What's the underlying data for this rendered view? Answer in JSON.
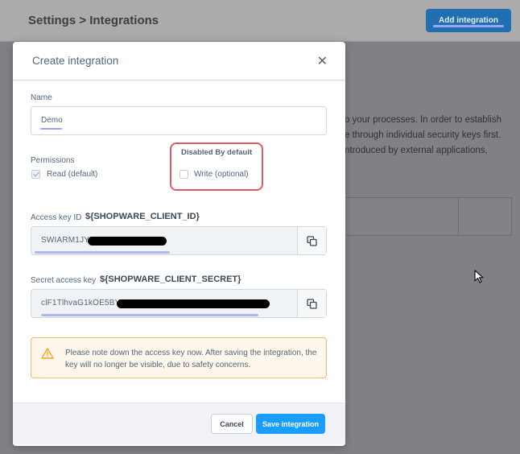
{
  "background": {
    "breadcrumb": "Settings > Integrations",
    "add_button": "Add integration",
    "description_lines": [
      "o your processes. In order to establish",
      "e through individual security keys first.",
      "ntroduced by external applications,"
    ]
  },
  "modal": {
    "title": "Create integration",
    "close_icon": "close-icon",
    "name": {
      "label": "Name",
      "value": "Demo"
    },
    "permissions": {
      "label": "Permissions",
      "read_label": "Read (default)",
      "read_checked": true,
      "disabled_title": "Disabled By default",
      "write_label": "Write (optional)",
      "write_checked": false
    },
    "access_key": {
      "label": "Access key ID",
      "variable": "${SHOPWARE_CLIENT_ID}",
      "value_visible": "SWIARM1JYZ"
    },
    "secret_key": {
      "label": "Secret access key",
      "variable": "${SHOPWARE_CLIENT_SECRET}",
      "value_visible": "clF1TlhvaG1kOE5BY2"
    },
    "alert": {
      "icon": "warning-icon",
      "text": "Please note down the access key now. After saving the integration, the key will no longer be visible, due to safety concerns."
    },
    "footer": {
      "cancel_label": "Cancel",
      "save_label": "Save integration"
    }
  },
  "colors": {
    "primary": "#189eff",
    "warning_border": "#f5b867",
    "highlight": "#e05a63"
  }
}
